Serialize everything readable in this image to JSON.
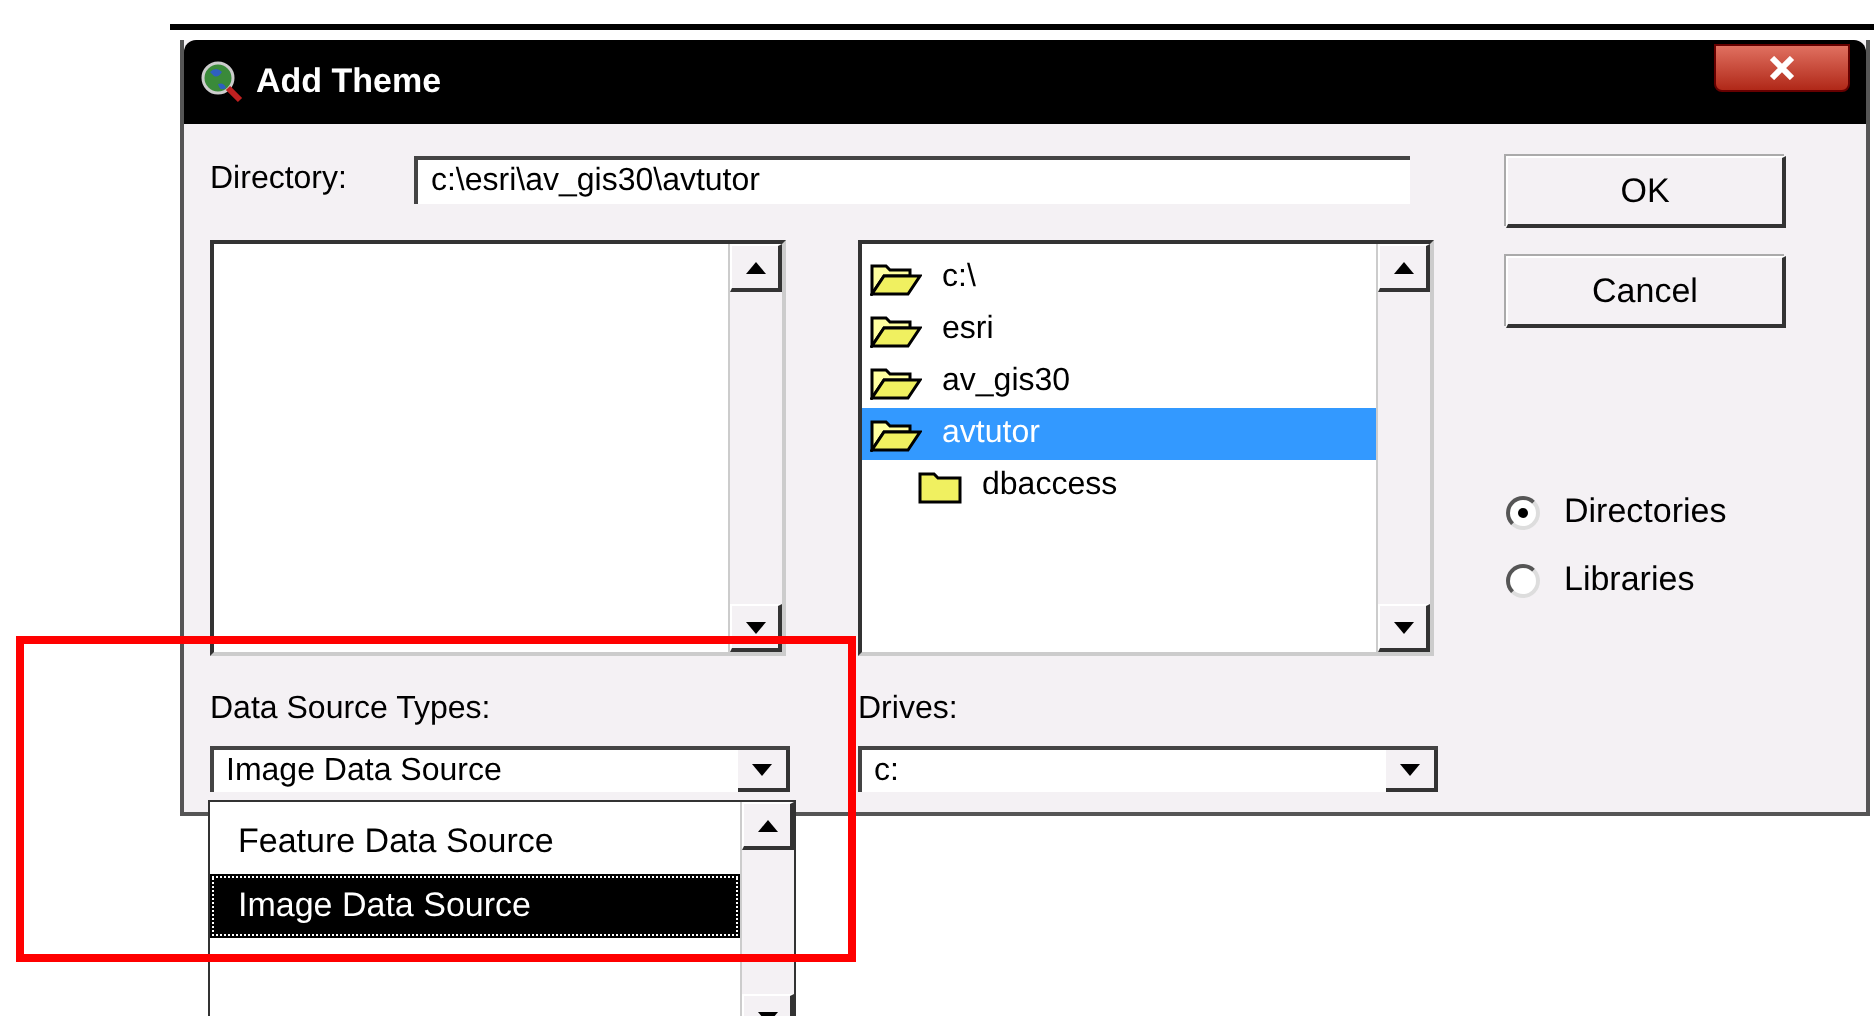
{
  "window": {
    "title": "Add Theme"
  },
  "directory": {
    "label": "Directory:",
    "value": "c:\\esri\\av_gis30\\avtutor"
  },
  "folders": [
    {
      "name": "c:\\",
      "open": true,
      "selected": false
    },
    {
      "name": "esri",
      "open": true,
      "selected": false
    },
    {
      "name": "av_gis30",
      "open": true,
      "selected": false
    },
    {
      "name": "avtutor",
      "open": true,
      "selected": true,
      "children": [
        {
          "name": "dbaccess",
          "open": false,
          "selected": false
        }
      ]
    }
  ],
  "buttons": [
    {
      "label": "OK"
    },
    {
      "label": "Cancel"
    }
  ],
  "list_type": [
    {
      "label": "Directories",
      "selected": true
    },
    {
      "label": "Libraries",
      "selected": false
    }
  ],
  "data_source_types": {
    "label": "Data Source Types:",
    "value": "Image Data Source",
    "expanded": true,
    "options": [
      {
        "label": "Feature Data Source",
        "selected": false
      },
      {
        "label": "Image Data Source",
        "selected": true
      }
    ]
  },
  "drives": {
    "label": "Drives:",
    "value": "c:"
  },
  "annotation": {
    "highlight_frame": true
  }
}
